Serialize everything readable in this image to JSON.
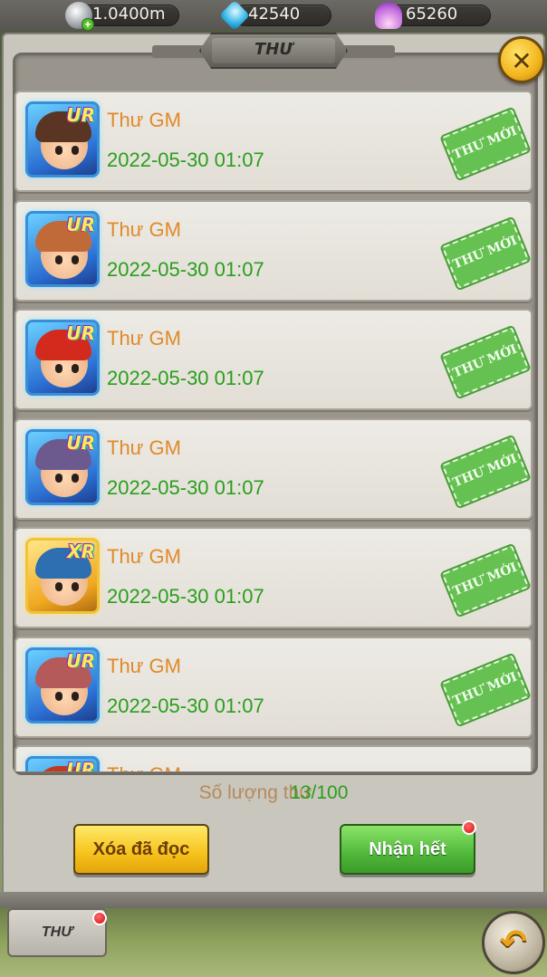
{
  "resources": {
    "silver": {
      "value": "1.0400m",
      "icon": "silver-coin-icon"
    },
    "gems": {
      "value": "42540",
      "icon": "blue-gem-icon"
    },
    "shells": {
      "value": "65260",
      "icon": "shell-icon"
    }
  },
  "window": {
    "title": "THƯ",
    "close_symbol": "✕"
  },
  "mails": [
    {
      "sender": "Thư GM",
      "date": "2022-05-30 01:07",
      "rarity": "UR",
      "status": "THƯ MỚI",
      "hair": "#5a3524"
    },
    {
      "sender": "Thư GM",
      "date": "2022-05-30 01:07",
      "rarity": "UR",
      "status": "THƯ MỚI",
      "hair": "#c06a3a"
    },
    {
      "sender": "Thư GM",
      "date": "2022-05-30 01:07",
      "rarity": "UR",
      "status": "THƯ MỚI",
      "hair": "#d32a1e"
    },
    {
      "sender": "Thư GM",
      "date": "2022-05-30 01:07",
      "rarity": "UR",
      "status": "THƯ MỚI",
      "hair": "#6c5a8e"
    },
    {
      "sender": "Thư GM",
      "date": "2022-05-30 01:07",
      "rarity": "XR",
      "status": "THƯ MỚI",
      "hair": "#2d6fb0"
    },
    {
      "sender": "Thư GM",
      "date": "2022-05-30 01:07",
      "rarity": "UR",
      "status": "THƯ MỚI",
      "hair": "#b45a5a"
    },
    {
      "sender": "Thư GM",
      "date": "",
      "rarity": "UR",
      "status": "",
      "hair": "#c23a1e"
    }
  ],
  "footer": {
    "count_label": "Số lượng thư",
    "count_value": "13/100",
    "delete_read": "Xóa đã đọc",
    "claim_all": "Nhận hết"
  },
  "bottom": {
    "tab_label": "THƯ",
    "back_symbol": "↶"
  },
  "colors": {
    "sender": "#e08a2a",
    "date": "#2a9e1c",
    "stamp": "#5fc04a",
    "ur_border": "#3a8ed8",
    "xr_border": "#f2c23a"
  }
}
